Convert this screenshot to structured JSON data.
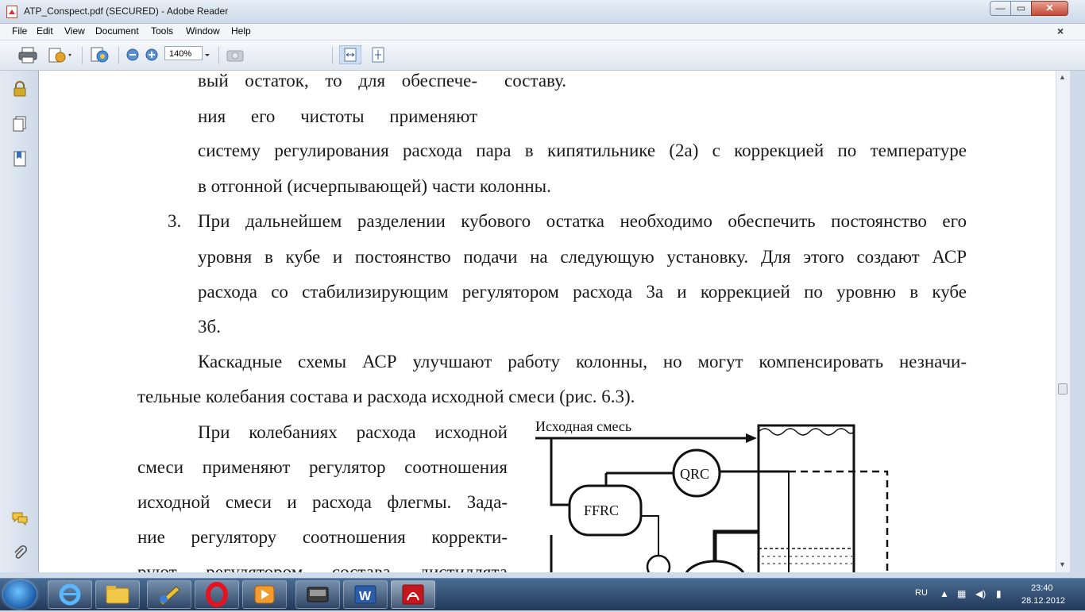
{
  "window": {
    "title": "ATP_Conspect.pdf (SECURED) - Adobe Reader",
    "min": "—",
    "max": "▭",
    "close": "✕"
  },
  "menu": [
    "File",
    "Edit",
    "View",
    "Document",
    "Tools",
    "Window",
    "Help"
  ],
  "menu_close": "×",
  "toolbar": {
    "zoom": "140%"
  },
  "doc": {
    "col_left_1": "вый  остаток,  то  для  обеспече-",
    "col_right_1": "составу.",
    "col_left_2": "ния    его    чистоты    применяют",
    "line_3": "систему регулирования расхода пара в кипятильнике (2а) с коррекцией по температуре",
    "line_4": "в отгонной (исчерпывающей) части колонны.",
    "item3_num": "3.",
    "item3_l1": "При дальнейшем разделении кубового остатка необходимо обеспечить постоянство его",
    "item3_l2": "уровня в кубе и постоянство подачи на следующую установку. Для этого создают АСР",
    "item3_l3": "расхода со стабилизирующим регулятором расхода 3а и коррекцией по уровню в кубе",
    "item3_l4": "3б.",
    "para_l1": "Каскадные схемы АСР улучшают работу колонны, но могут компенсировать незначи-",
    "para_l2": "тельные колебания состава и расхода исходной смеси (рис. 6.3).",
    "p2_l1": "При   колебаниях   расхода   исходной",
    "p2_l2": "смеси применяют регулятор соотношения",
    "p2_l3": "исходной смеси и расхода флегмы. Зада-",
    "p2_l4": "ние   регулятору   соотношения   корректи-",
    "p2_l5": "руют   регулятором   состава   дистиллята",
    "diagram": {
      "feed_label": "Исходная смесь",
      "qrc": "QRC",
      "ffrc": "FFRC"
    }
  },
  "taskbar": {
    "lang": "RU",
    "time": "23:40",
    "date": "28.12.2012"
  }
}
